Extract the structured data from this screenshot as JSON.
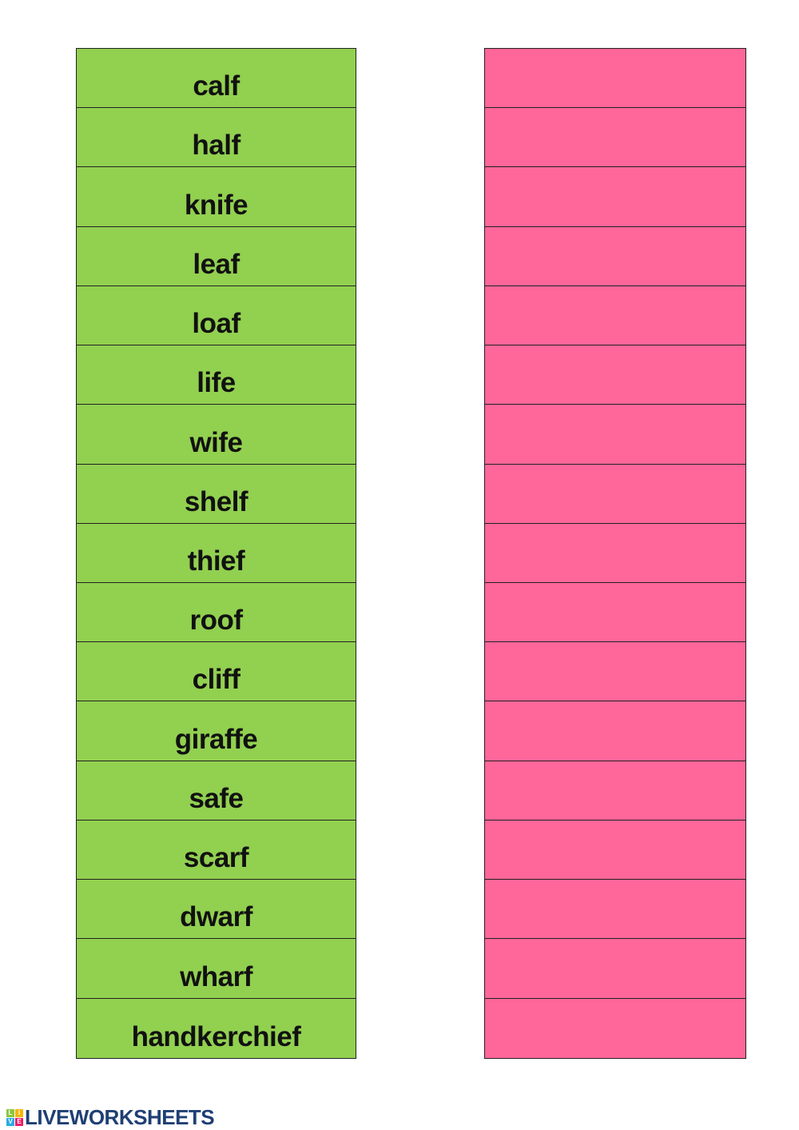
{
  "colors": {
    "word_column": "#92d050",
    "answer_column": "#ff6699",
    "logo": "#1f3f74"
  },
  "words": [
    "calf",
    "half",
    "knife",
    "leaf",
    "loaf",
    "life",
    "wife",
    "shelf",
    "thief",
    "roof",
    "cliff",
    "giraffe",
    "safe",
    "scarf",
    "dwarf",
    "wharf",
    "handkerchief"
  ],
  "answers": [
    "",
    "",
    "",
    "",
    "",
    "",
    "",
    "",
    "",
    "",
    "",
    "",
    "",
    "",
    "",
    "",
    ""
  ],
  "logo": {
    "text": "LIVEWORKSHEETS",
    "mark_letters": [
      "L",
      "I",
      "V",
      "E"
    ]
  }
}
